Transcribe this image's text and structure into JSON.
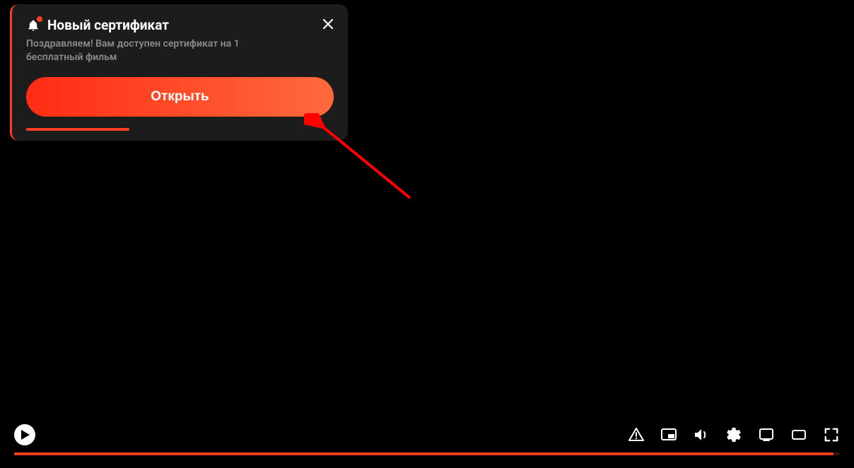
{
  "notification": {
    "title": "Новый сертификат",
    "body": "Поздравляем! Вам доступен сертификат на 1 бесплатный фильм",
    "open_label": "Открыть",
    "progress_percent": 33
  },
  "player": {
    "progress_percent": 99.2
  },
  "colors": {
    "accent": "#ff3c1f",
    "card_bg": "#1c1c1c",
    "muted_text": "#8a8a8a"
  }
}
